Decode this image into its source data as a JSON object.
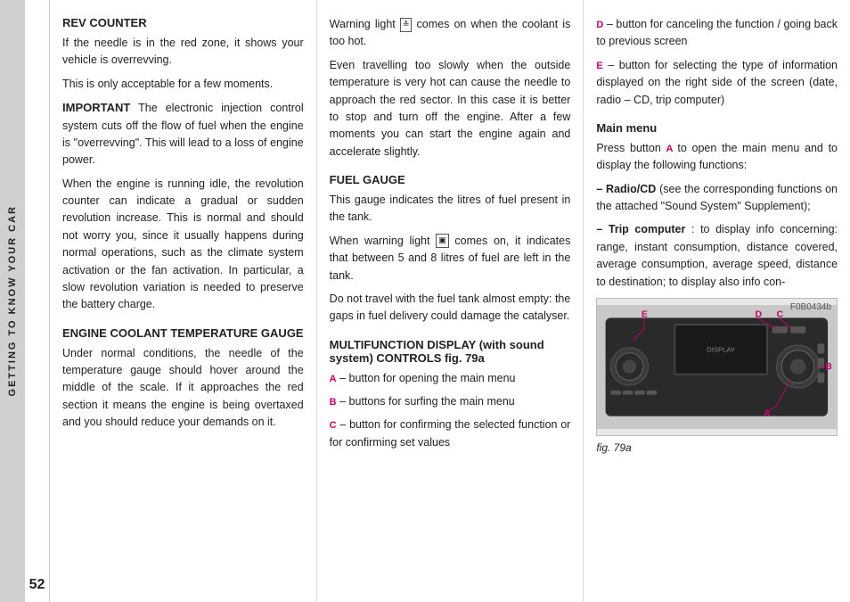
{
  "sidebar": {
    "text": "GETTING TO KNOW YOUR CAR"
  },
  "page_number": "52",
  "col1": {
    "heading1": "REV COUNTER",
    "p1": "If the needle is in the red zone, it shows your vehicle is overrevving.",
    "p2": "This is only acceptable for a few moments.",
    "important_label": "IMPORTANT",
    "p3": " The electronic injection control system cuts off the flow of fuel when the engine is \"overrevving\". This will lead to a loss of engine power.",
    "p4": "When the engine is running idle, the revolution counter can indicate a gradual or sudden revolution increase. This is normal and should not worry you, since it usually happens during normal operations, such as the climate system activation or the fan activation. In particular, a slow revolution variation is needed to preserve the battery charge.",
    "heading2": "ENGINE COOLANT TEMPERATURE GAUGE",
    "p5": "Under normal conditions, the needle of the temperature gauge should hover around the middle of the scale. If it approaches the red section it means the engine is being overtaxed and you should reduce your demands on it."
  },
  "col2": {
    "p1": "Warning light",
    "icon1": "≛",
    "p1b": "comes on when the coolant is too hot.",
    "p2": "Even travelling too slowly when the outside temperature is very hot can cause the needle to approach the red sector. In this case it is better to stop and turn off the engine. After a few moments you can start the engine again and accelerate slightly.",
    "heading1": "FUEL GAUGE",
    "p3": "This gauge indicates the litres of fuel present in the tank.",
    "p4": "When warning light",
    "icon2": "▣",
    "p4b": "comes on, it indicates that between 5 and 8 litres of fuel are left in the tank.",
    "p5": "Do not travel with the fuel tank almost empty: the gaps in fuel delivery could damage the catalyser.",
    "heading2": "MULTIFUNCTION DISPLAY (with sound system) CONTROLS fig. 79a",
    "controls": [
      {
        "label": "A",
        "text": "– button for opening the main menu"
      },
      {
        "label": "B",
        "text": "– buttons for surfing the main menu"
      },
      {
        "label": "C",
        "text": "– button for confirming the selected function or for confirming set values"
      }
    ]
  },
  "col3": {
    "controls": [
      {
        "label": "D",
        "text": "– button for canceling the function / going back to previous screen"
      },
      {
        "label": "E",
        "text": "– button for selecting the type of information displayed on the right side of the screen (date, radio – CD, trip computer)"
      }
    ],
    "heading1": "Main menu",
    "p1": "Press button",
    "letter_A": "A",
    "p1b": "to open the main menu and to display the following functions:",
    "items": [
      {
        "label": "– Radio/CD",
        "text": "(see the corresponding functions on the attached \"Sound System\" Supplement);"
      },
      {
        "label": "– Trip computer",
        "text": ": to display info concerning: range, instant consumption, distance covered, average consumption, average speed, distance to destination; to display also info con-"
      }
    ],
    "figure": {
      "ref": "F0B0434b",
      "caption": "fig. 79a",
      "labels": [
        "E",
        "D",
        "C",
        "B",
        "A"
      ]
    }
  }
}
